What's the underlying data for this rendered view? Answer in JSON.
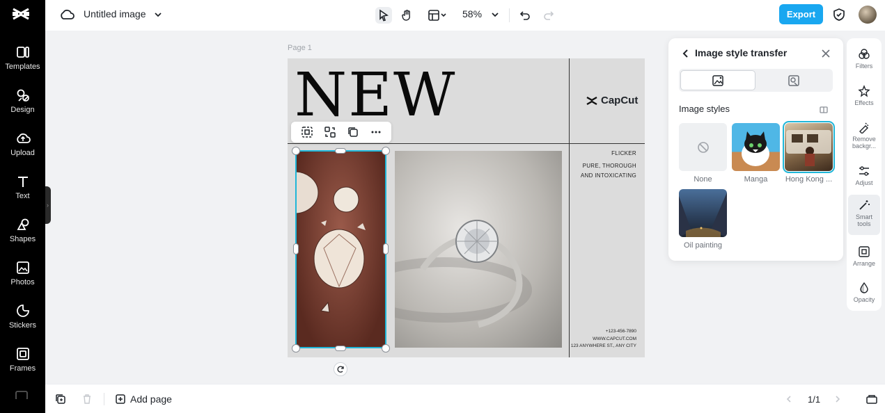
{
  "left_rail": {
    "items": [
      {
        "label": "Templates",
        "icon": "templates-icon"
      },
      {
        "label": "Design",
        "icon": "design-icon"
      },
      {
        "label": "Upload",
        "icon": "upload-icon"
      },
      {
        "label": "Text",
        "icon": "text-icon"
      },
      {
        "label": "Shapes",
        "icon": "shapes-icon"
      },
      {
        "label": "Photos",
        "icon": "photos-icon"
      },
      {
        "label": "Stickers",
        "icon": "stickers-icon"
      },
      {
        "label": "Frames",
        "icon": "frames-icon"
      }
    ]
  },
  "topbar": {
    "doc_title": "Untitled image",
    "zoom": "58%",
    "export_label": "Export"
  },
  "canvas": {
    "page_label": "Page 1",
    "headline": "NEW",
    "brand": "CapCut",
    "tagline": [
      "FLICKER",
      "PURE, THOROUGH",
      "AND INTOXICATING"
    ],
    "contact": [
      "+123-456-7890",
      "WWW.CAPCUT.COM",
      "123 ANYWHERE ST., ANY CITY"
    ]
  },
  "panel": {
    "title": "Image style transfer",
    "styles_heading": "Image styles",
    "styles": [
      {
        "name": "None",
        "selected": false
      },
      {
        "name": "Manga",
        "selected": false
      },
      {
        "name": "Hong Kong ...",
        "selected": true
      },
      {
        "name": "Oil painting",
        "selected": false
      }
    ]
  },
  "right_rail": {
    "items": [
      {
        "label": "Filters",
        "active": false
      },
      {
        "label": "Effects",
        "active": false
      },
      {
        "label": "Remove backgr...",
        "active": false
      },
      {
        "label": "Adjust",
        "active": false
      },
      {
        "label": "Smart tools",
        "active": true
      },
      {
        "label": "Arrange",
        "active": false
      },
      {
        "label": "Opacity",
        "active": false
      }
    ]
  },
  "bottombar": {
    "add_page_label": "Add page",
    "page_counter": "1/1"
  },
  "colors": {
    "accent": "#19a7f0",
    "selection": "#1fb6d8"
  }
}
